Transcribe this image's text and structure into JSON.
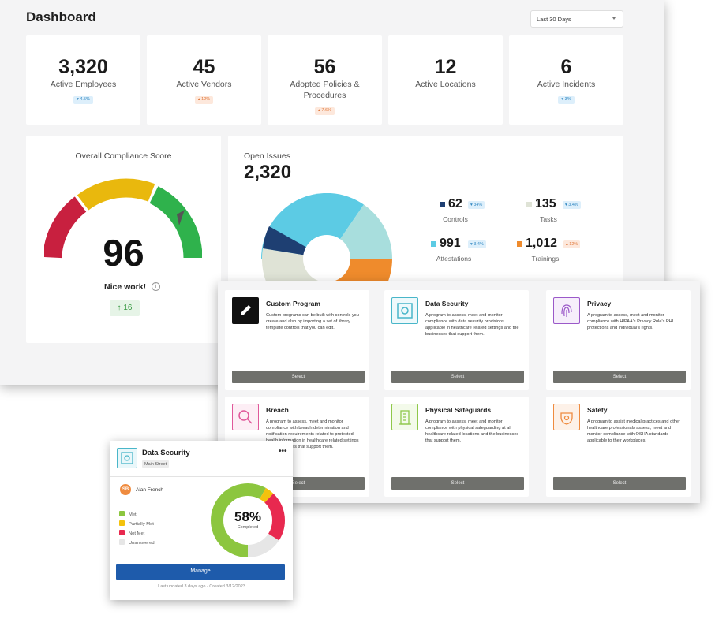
{
  "dashboard": {
    "title": "Dashboard",
    "date_range": "Last 30 Days",
    "stats": [
      {
        "value": "3,320",
        "label": "Active Employees",
        "change": "▾ 4.5%",
        "dir": "down"
      },
      {
        "value": "45",
        "label": "Active Vendors",
        "change": "▴ 12%",
        "dir": "up"
      },
      {
        "value": "56",
        "label": "Adopted Policies & Procedures",
        "change": "▴ 7.6%",
        "dir": "up"
      },
      {
        "value": "12",
        "label": "Active Locations",
        "change": "",
        "dir": "none"
      },
      {
        "value": "6",
        "label": "Active Incidents",
        "change": "▾ 3%",
        "dir": "down"
      }
    ],
    "compliance": {
      "title": "Overall Compliance Score",
      "score": "96",
      "message": "Nice work!",
      "info_icon": "info-icon",
      "delta": "↑ 16",
      "colors": {
        "red": "#c8203f",
        "yellow": "#e9b80d",
        "green": "#2fb24c"
      }
    },
    "issues": {
      "title": "Open Issues",
      "total": "2,320",
      "legend": [
        {
          "value": "62",
          "label": "Controls",
          "change": "▾ 34%",
          "dir": "down",
          "color": "#1e3f72"
        },
        {
          "value": "135",
          "label": "Tasks",
          "change": "▾ 3.4%",
          "dir": "down",
          "color": "#dfe3d6"
        },
        {
          "value": "991",
          "label": "Attestations",
          "change": "▾ 3.4%",
          "dir": "down",
          "color": "#5ccbe4"
        },
        {
          "value": "1,012",
          "label": "Trainings",
          "change": "▴ 12%",
          "dir": "up",
          "color": "#ef8b2c"
        }
      ]
    }
  },
  "programs": [
    {
      "title": "Custom Program",
      "icon": "pencil-icon",
      "color": "#111111",
      "desc": "Custom programs can be built with controls you create and also by importing a set of library template controls that you can edit.",
      "button": "Select"
    },
    {
      "title": "Data Security",
      "icon": "safe-icon",
      "color": "#49b6c9",
      "desc": "A program to assess, meet and monitor compliance with data security provisions applicable in healthcare related settings and the businesses that support them.",
      "button": "Select"
    },
    {
      "title": "Privacy",
      "icon": "fingerprint-icon",
      "color": "#9b59c9",
      "desc": "A program to assess, meet and monitor compliance with HIPAA's Privacy Rule's PHI protections and individual's rights.",
      "button": "Select"
    },
    {
      "title": "Breach",
      "icon": "magnifier-icon",
      "color": "#e0589a",
      "desc": "A program to assess, meet and monitor compliance with breach determination and notification requirements related to protected health information in healthcare related settings and businesses that support them.",
      "button": "Select"
    },
    {
      "title": "Physical Safeguards",
      "icon": "building-icon",
      "color": "#8fc84a",
      "desc": "A program to assess, meet and monitor compliance with physical safeguarding at all healthcare related locations and the businesses that support them.",
      "button": "Select"
    },
    {
      "title": "Safety",
      "icon": "hazard-icon",
      "color": "#ef8b3f",
      "desc": "A program to assist medical practices and other healthcare professionals assess, meet and monitor compliance with OSHA standards applicable to their workplaces.",
      "button": "Select"
    }
  ],
  "ds_card": {
    "title": "Data Security",
    "location": "Main Street",
    "more": "•••",
    "avatar": "SB",
    "user": "Alan French",
    "legend": [
      {
        "label": "Met",
        "color": "#8cc63f"
      },
      {
        "label": "Partially Met",
        "color": "#f4c20d"
      },
      {
        "label": "Not Met",
        "color": "#e8294f"
      },
      {
        "label": "Unanswered",
        "color": "#e6e6e6"
      }
    ],
    "segments": [
      58,
      4,
      22,
      16
    ],
    "percent": "58%",
    "percent_label": "Completed",
    "button": "Manage",
    "footer": "Last updated 3 days ago · Created 3/12/2023"
  }
}
